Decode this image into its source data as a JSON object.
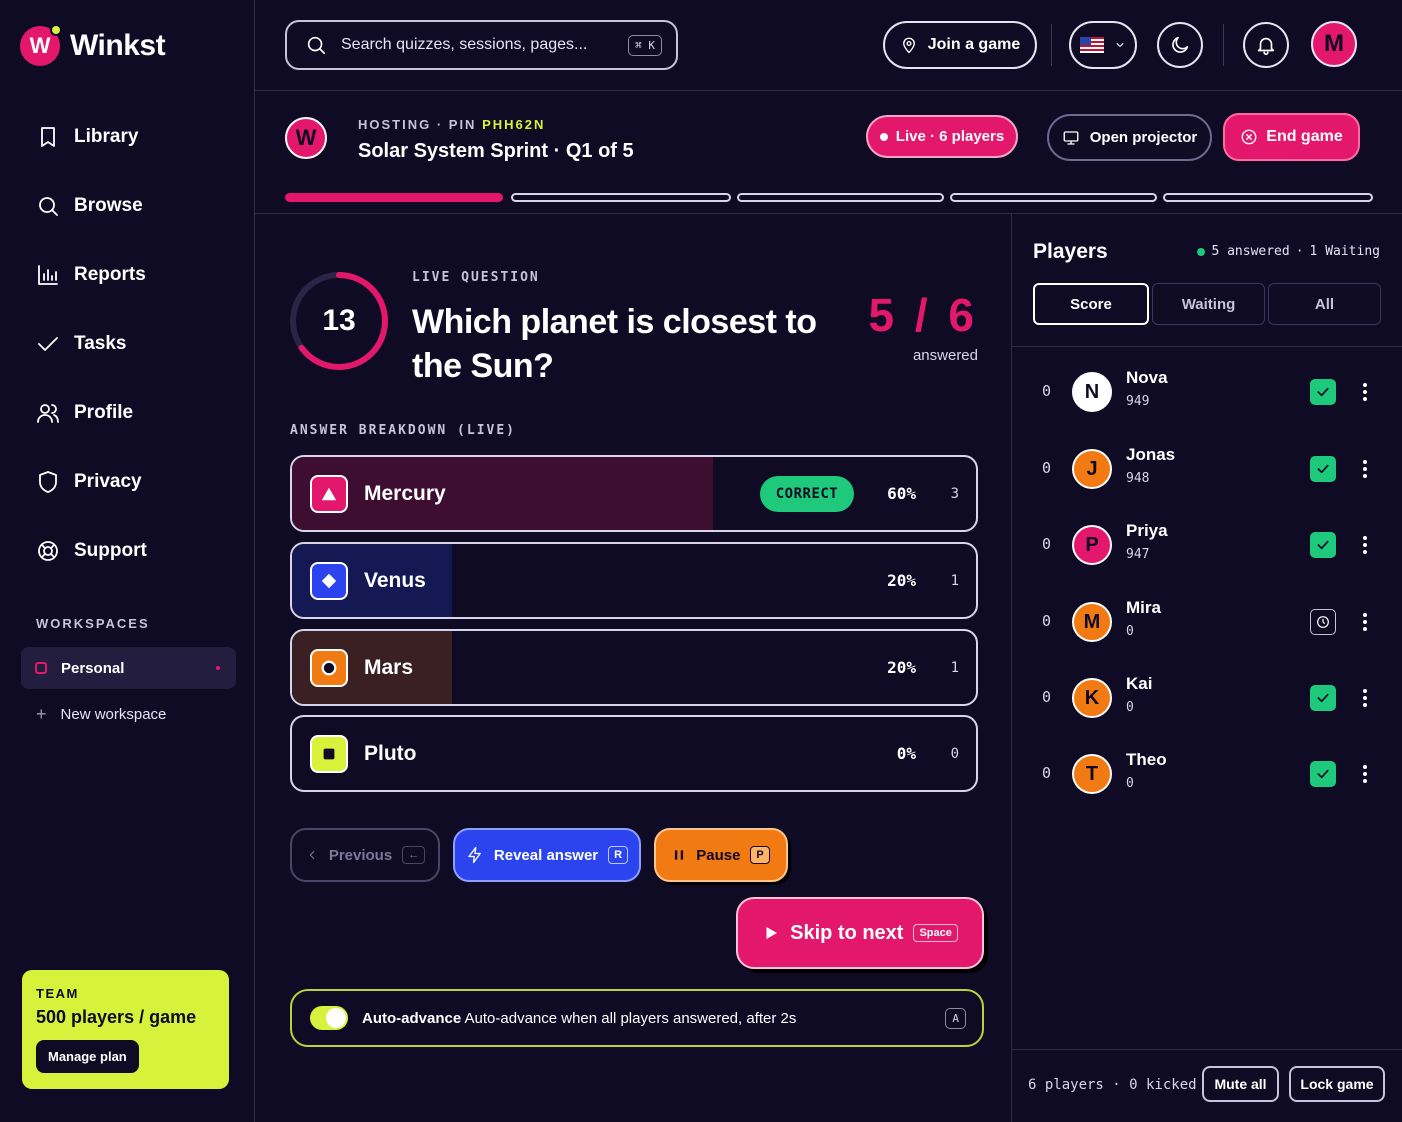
{
  "app": {
    "name": "Winkst",
    "logo_letter": "W",
    "accent": "#e3186c",
    "lime": "#d7f23a"
  },
  "sidebar": {
    "items": [
      {
        "label": "Library",
        "icon": "bookmark-icon"
      },
      {
        "label": "Browse",
        "icon": "search-icon"
      },
      {
        "label": "Reports",
        "icon": "bar-chart-icon"
      },
      {
        "label": "Tasks",
        "icon": "check-icon"
      },
      {
        "label": "Profile",
        "icon": "users-icon"
      },
      {
        "label": "Privacy",
        "icon": "shield-icon"
      },
      {
        "label": "Support",
        "icon": "lifebuoy-icon"
      }
    ],
    "workspaces_title": "WORKSPACES",
    "workspace_active": "Personal",
    "new_workspace": "New workspace",
    "team": {
      "label": "TEAM",
      "value": "500 players / game",
      "button": "Manage plan"
    }
  },
  "topbar": {
    "search_placeholder": "Search quizzes, sessions, pages...",
    "search_shortcut": "⌘ K",
    "join_label": "Join a game",
    "avatar_letter": "M"
  },
  "session": {
    "avatar_letter": "W",
    "hosting_prefix": "HOSTING · PIN ",
    "pin": "PHH62N",
    "title": "Solar System Sprint · Q1 of 5",
    "live_label": "Live · 6 players",
    "projector_label": "Open projector",
    "end_label": "End game",
    "progress_total": 5,
    "progress_current": 1
  },
  "question": {
    "timer": "13",
    "timer_fraction": 0.65,
    "label": "LIVE QUESTION",
    "text": "Which planet is closest to the Sun?",
    "answered_count": "5 / 6",
    "answered_label": "answered",
    "breakdown_label": "ANSWER BREAKDOWN (LIVE)",
    "answers": [
      {
        "label": "Mercury",
        "percent": "60%",
        "count": "3",
        "fraction": 0.6,
        "color": "#e3186c",
        "fill": "#3d0d32",
        "correct": true,
        "shape": "triangle"
      },
      {
        "label": "Venus",
        "percent": "20%",
        "count": "1",
        "fraction": 0.2,
        "color": "#2b44f0",
        "fill": "#141954",
        "correct": false,
        "shape": "diamond"
      },
      {
        "label": "Mars",
        "percent": "20%",
        "count": "1",
        "fraction": 0.2,
        "color": "#f27a12",
        "fill": "#3a2023",
        "correct": false,
        "shape": "circle"
      },
      {
        "label": "Pluto",
        "percent": "0%",
        "count": "0",
        "fraction": 0,
        "color": "#d7f23a",
        "fill": "#1a1a1a",
        "correct": false,
        "shape": "square"
      }
    ],
    "correct_label": "CORRECT"
  },
  "controls": {
    "previous": "Previous",
    "previous_key": "←",
    "reveal": "Reveal answer",
    "reveal_key": "R",
    "pause": "Pause",
    "pause_key": "P",
    "skip": "Skip to next",
    "skip_key": "Space",
    "auto_title": "Auto-advance",
    "auto_text": "Auto-advance when all players answered, after 2s",
    "auto_key": "A",
    "auto_on": true
  },
  "players": {
    "title": "Players",
    "answered": "5 answered",
    "waiting": "1 Waiting",
    "tabs": [
      "Score",
      "Waiting",
      "All"
    ],
    "list": [
      {
        "rank": "0",
        "letter": "N",
        "name": "Nova",
        "score": "949",
        "color": "#ffffff",
        "status": "answered"
      },
      {
        "rank": "0",
        "letter": "J",
        "name": "Jonas",
        "score": "948",
        "color": "#f27a12",
        "status": "answered"
      },
      {
        "rank": "0",
        "letter": "P",
        "name": "Priya",
        "score": "947",
        "color": "#e3186c",
        "status": "answered"
      },
      {
        "rank": "0",
        "letter": "M",
        "name": "Mira",
        "score": "0",
        "color": "#f27a12",
        "status": "waiting"
      },
      {
        "rank": "0",
        "letter": "K",
        "name": "Kai",
        "score": "0",
        "color": "#f27a12",
        "status": "answered"
      },
      {
        "rank": "0",
        "letter": "T",
        "name": "Theo",
        "score": "0",
        "color": "#f27a12",
        "status": "answered"
      }
    ],
    "footer": "6 players · 0 kicked",
    "mute_all": "Mute all",
    "lock_game": "Lock game"
  }
}
